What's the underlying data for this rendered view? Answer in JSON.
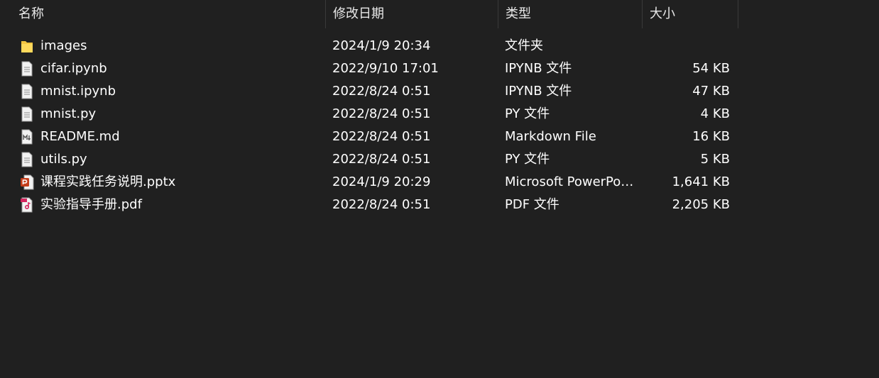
{
  "columns": {
    "name": "名称",
    "date": "修改日期",
    "type": "类型",
    "size": "大小"
  },
  "files": [
    {
      "icon": "folder-icon",
      "name": "images",
      "date": "2024/1/9 20:34",
      "type": "文件夹",
      "size": ""
    },
    {
      "icon": "generic-file-icon",
      "name": "cifar.ipynb",
      "date": "2022/9/10 17:01",
      "type": "IPYNB 文件",
      "size": "54 KB"
    },
    {
      "icon": "generic-file-icon",
      "name": "mnist.ipynb",
      "date": "2022/8/24 0:51",
      "type": "IPYNB 文件",
      "size": "47 KB"
    },
    {
      "icon": "generic-file-icon",
      "name": "mnist.py",
      "date": "2022/8/24 0:51",
      "type": "PY 文件",
      "size": "4 KB"
    },
    {
      "icon": "markdown-file-icon",
      "name": "README.md",
      "date": "2022/8/24 0:51",
      "type": "Markdown File",
      "size": "16 KB"
    },
    {
      "icon": "generic-file-icon",
      "name": "utils.py",
      "date": "2022/8/24 0:51",
      "type": "PY 文件",
      "size": "5 KB"
    },
    {
      "icon": "powerpoint-file-icon",
      "name": "课程实践任务说明.pptx",
      "date": "2024/1/9 20:29",
      "type": "Microsoft PowerPoi...",
      "size": "1,641 KB"
    },
    {
      "icon": "pdf-file-icon",
      "name": "实验指导手册.pdf",
      "date": "2022/8/24 0:51",
      "type": "PDF 文件",
      "size": "2,205 KB"
    }
  ],
  "colors": {
    "background": "#202020",
    "folder": "#f4c542",
    "powerpoint": "#c43e1c",
    "pdf": "#d4265e"
  }
}
